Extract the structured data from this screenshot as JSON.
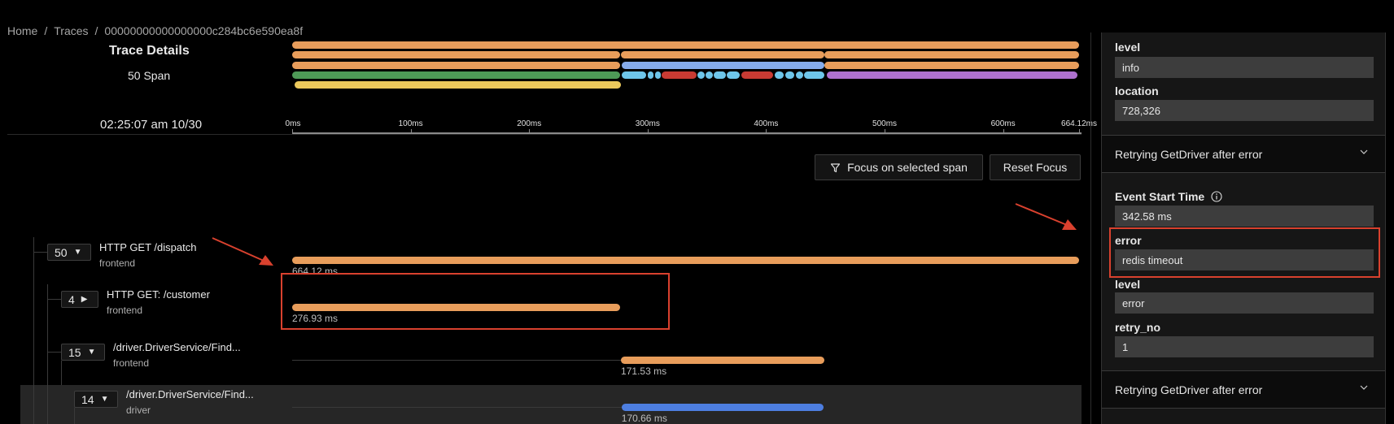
{
  "breadcrumb": {
    "items": [
      "Home",
      "Traces",
      "00000000000000000c284bc6e590ea8f"
    ],
    "separator": "/"
  },
  "trace": {
    "title": "Trace Details",
    "span_count": "50 Span",
    "start_time": "02:25:07 am 10/30",
    "total_ms": 664.12
  },
  "colors": {
    "orange": "#e89d5b",
    "blue_light": "#86aceb",
    "blue": "#4d7ee0",
    "cyan": "#6ec6ea",
    "green": "#4e9a57",
    "yellow": "#ecc95c",
    "red": "#c83b33",
    "purple": "#ae71cf",
    "annotation_red": "#d9412e"
  },
  "minimap": {
    "rows": [
      [
        {
          "start": 0,
          "end": 664.12,
          "color": "orange"
        }
      ],
      [
        {
          "start": 0,
          "end": 276.93,
          "color": "orange"
        },
        {
          "start": 277.5,
          "end": 449,
          "color": "orange"
        },
        {
          "start": 449.5,
          "end": 664.12,
          "color": "orange"
        }
      ],
      [
        {
          "start": 0,
          "end": 276.93,
          "color": "orange"
        },
        {
          "start": 278,
          "end": 449,
          "color": "blue_light"
        },
        {
          "start": 449.5,
          "end": 664.12,
          "color": "orange"
        }
      ],
      [
        {
          "start": 0,
          "end": 276.93,
          "color": "green"
        },
        {
          "start": 278,
          "end": 299,
          "color": "cyan"
        },
        {
          "start": 300,
          "end": 305,
          "color": "cyan"
        },
        {
          "start": 306,
          "end": 311,
          "color": "cyan"
        },
        {
          "start": 312,
          "end": 341,
          "color": "red"
        },
        {
          "start": 342,
          "end": 348,
          "color": "cyan"
        },
        {
          "start": 349,
          "end": 355,
          "color": "cyan"
        },
        {
          "start": 356,
          "end": 366,
          "color": "cyan"
        },
        {
          "start": 367,
          "end": 378,
          "color": "cyan"
        },
        {
          "start": 379,
          "end": 406,
          "color": "red"
        },
        {
          "start": 407,
          "end": 415,
          "color": "cyan"
        },
        {
          "start": 416,
          "end": 424,
          "color": "cyan"
        },
        {
          "start": 425,
          "end": 431,
          "color": "cyan"
        },
        {
          "start": 432,
          "end": 449,
          "color": "cyan"
        },
        {
          "start": 451,
          "end": 663,
          "color": "purple"
        }
      ],
      [
        {
          "start": 2,
          "end": 277.5,
          "color": "yellow"
        }
      ]
    ]
  },
  "axis": {
    "ticks": [
      {
        "value": 0,
        "label": "0ms"
      },
      {
        "value": 100,
        "label": "100ms"
      },
      {
        "value": 200,
        "label": "200ms"
      },
      {
        "value": 300,
        "label": "300ms"
      },
      {
        "value": 400,
        "label": "400ms"
      },
      {
        "value": 500,
        "label": "500ms"
      },
      {
        "value": 600,
        "label": "600ms"
      },
      {
        "value": 664.12,
        "label": "664.12ms"
      }
    ]
  },
  "toolbar": {
    "focus_label": "Focus on selected span",
    "reset_label": "Reset Focus"
  },
  "spans": [
    {
      "count": "50",
      "expanded": true,
      "name": "HTTP GET /dispatch",
      "service": "frontend",
      "start": 0,
      "duration": 664.12,
      "duration_label": "664.12 ms",
      "color": "orange"
    },
    {
      "count": "4",
      "expanded": false,
      "name": "HTTP GET: /customer",
      "service": "frontend",
      "start": 0,
      "duration": 276.93,
      "duration_label": "276.93 ms",
      "color": "orange"
    },
    {
      "count": "15",
      "expanded": true,
      "name": "/driver.DriverService/Find...",
      "service": "frontend",
      "start": 277.5,
      "duration": 171.53,
      "duration_label": "171.53 ms",
      "color": "orange"
    },
    {
      "count": "14",
      "expanded": true,
      "name": "/driver.DriverService/Find...",
      "service": "driver",
      "start": 278,
      "duration": 170.66,
      "duration_label": "170.66 ms",
      "color": "blue",
      "selected": true
    }
  ],
  "details": {
    "top_fields": [
      {
        "label": "level",
        "value": "info"
      },
      {
        "label": "location",
        "value": "728,326"
      }
    ],
    "event1_title": "Retrying GetDriver after error",
    "event_start_label": "Event Start Time",
    "event_start_value": "342.58 ms",
    "event_fields": [
      {
        "label": "error",
        "value": "redis timeout"
      },
      {
        "label": "level",
        "value": "error"
      },
      {
        "label": "retry_no",
        "value": "1"
      }
    ],
    "event2_title": "Retrying GetDriver after error"
  }
}
